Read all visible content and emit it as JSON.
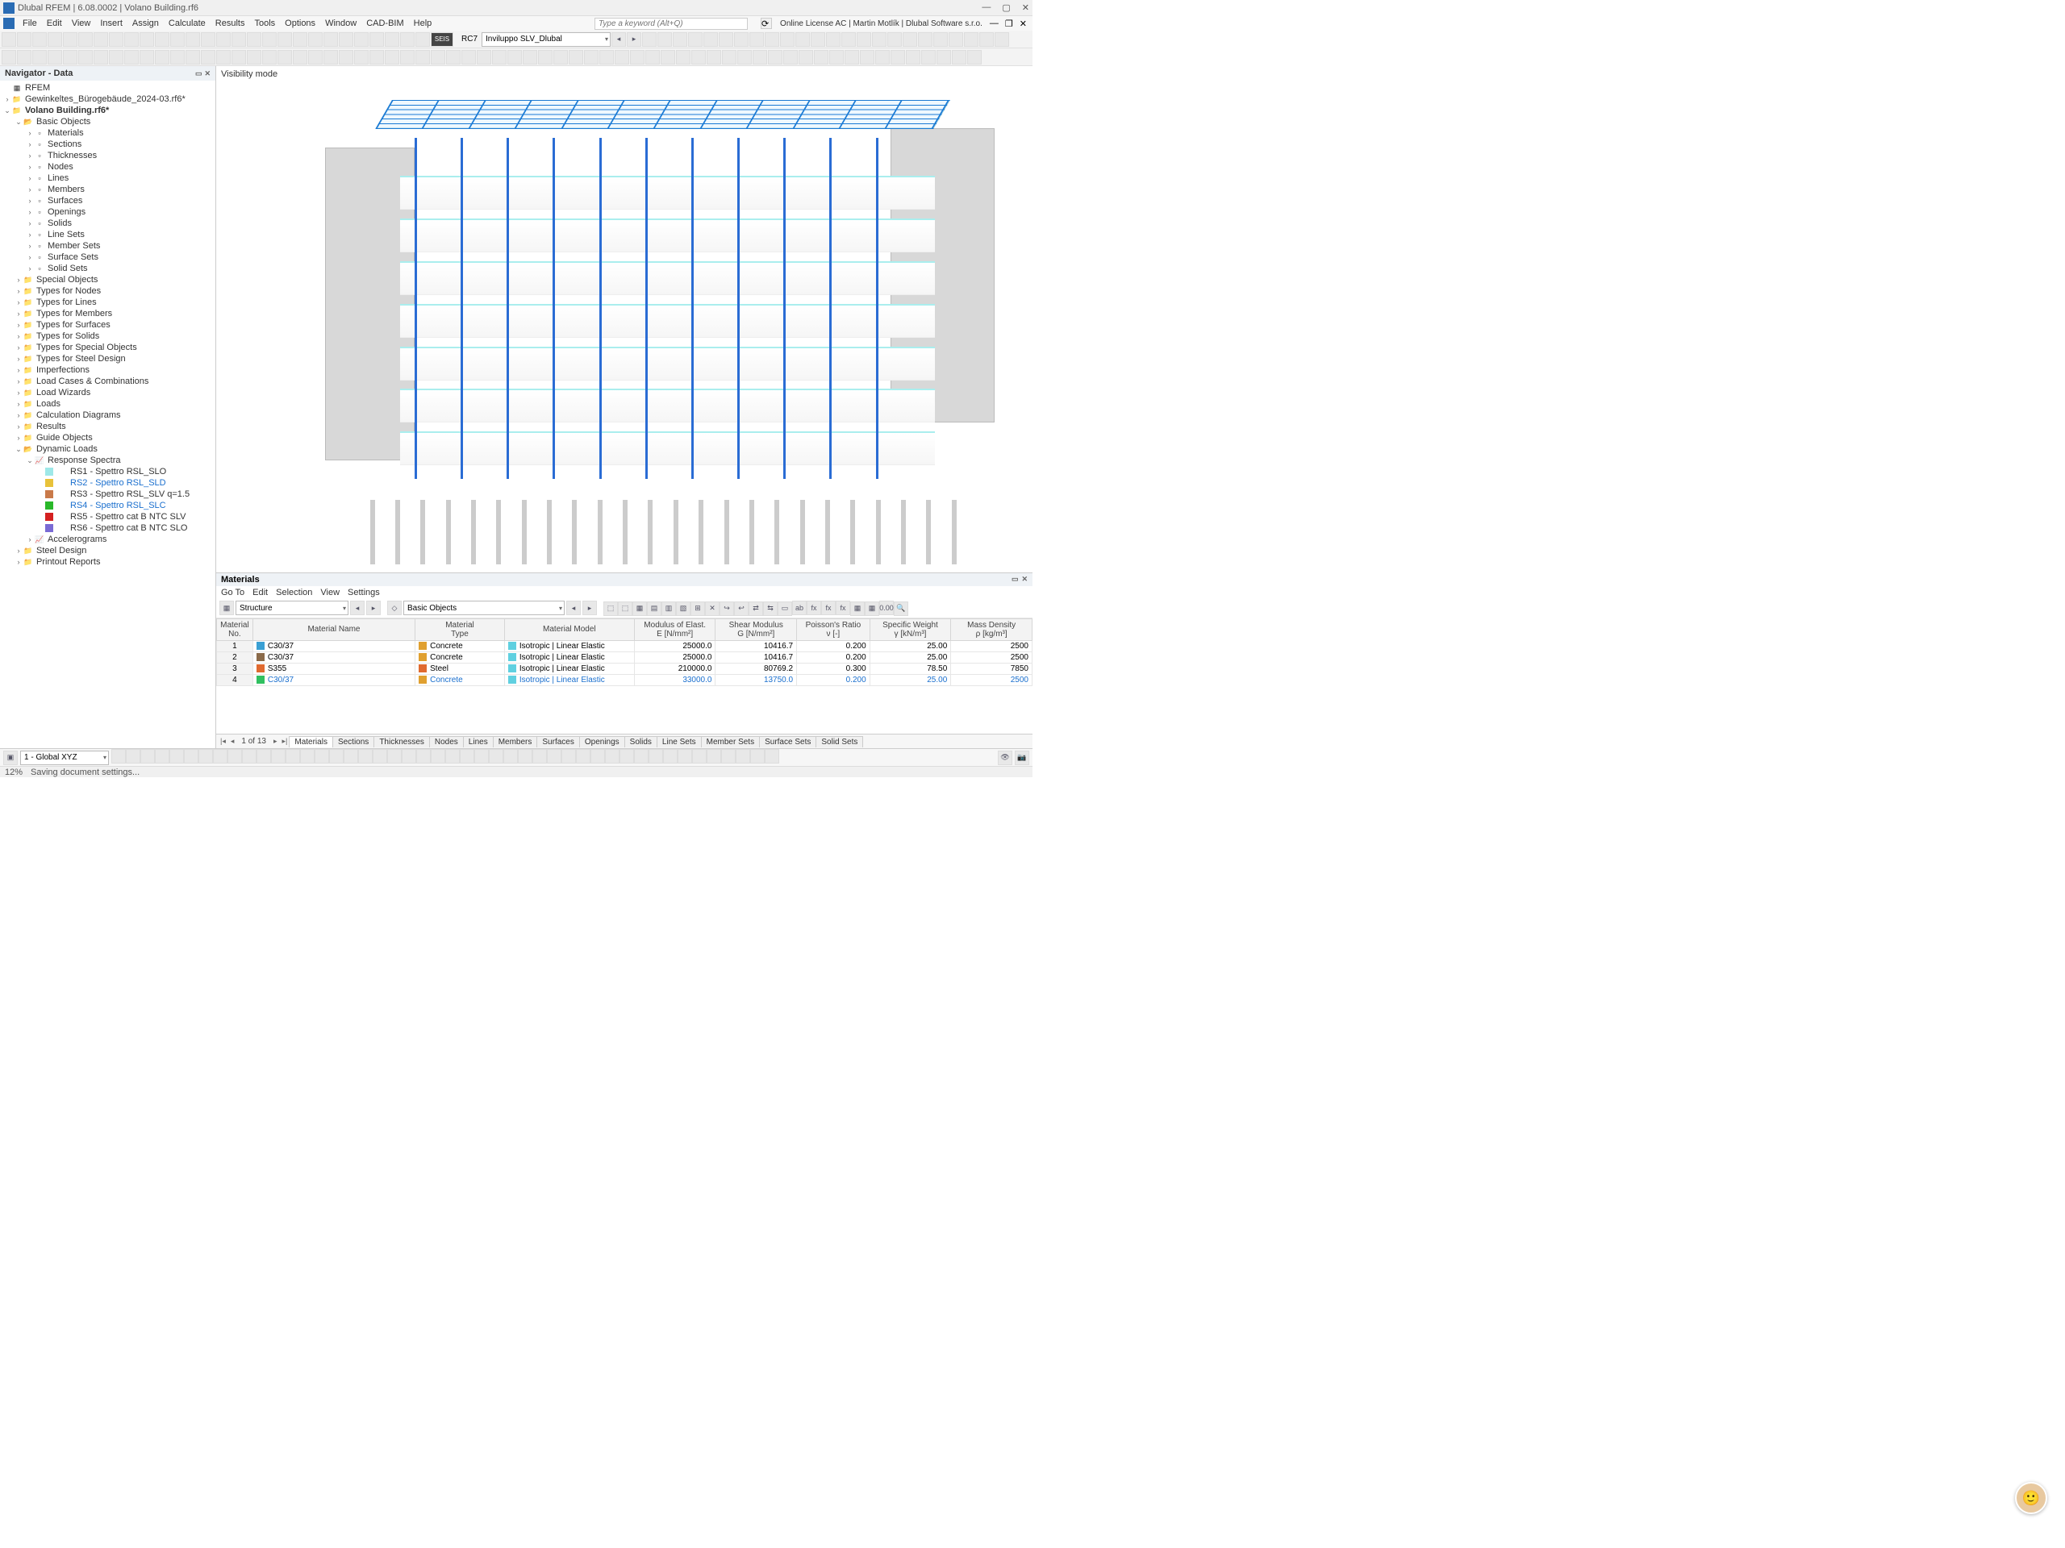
{
  "title": "Dlubal RFEM | 6.08.0002 | Volano Building.rf6",
  "menus": [
    "File",
    "Edit",
    "View",
    "Insert",
    "Assign",
    "Calculate",
    "Results",
    "Tools",
    "Options",
    "Window",
    "CAD-BIM",
    "Help"
  ],
  "keyword_placeholder": "Type a keyword (Alt+Q)",
  "license_text": "Online License AC | Martin Motlík | Dlubal Software s.r.o.",
  "toolbar1": {
    "rc_label": "RC7",
    "combo_value": "Inviluppo SLV_Dlubal",
    "seis": "SEIS"
  },
  "navigator": {
    "title": "Navigator - Data",
    "root": "RFEM",
    "files": [
      "Gewinkeltes_Bürogebäude_2024-03.rf6*",
      "Volano Building.rf6*"
    ],
    "basic_objects": {
      "label": "Basic Objects",
      "children": [
        "Materials",
        "Sections",
        "Thicknesses",
        "Nodes",
        "Lines",
        "Members",
        "Surfaces",
        "Openings",
        "Solids",
        "Line Sets",
        "Member Sets",
        "Surface Sets",
        "Solid Sets"
      ]
    },
    "groups": [
      "Special Objects",
      "Types for Nodes",
      "Types for Lines",
      "Types for Members",
      "Types for Surfaces",
      "Types for Solids",
      "Types for Special Objects",
      "Types for Steel Design",
      "Imperfections",
      "Load Cases & Combinations",
      "Load Wizards",
      "Loads",
      "Calculation Diagrams",
      "Results",
      "Guide Objects"
    ],
    "dynamic": {
      "label": "Dynamic Loads",
      "rs_label": "Response Spectra",
      "spectra": [
        {
          "name": "RS1 - Spettro RSL_SLO",
          "color": "#9ee8e8",
          "sel": false
        },
        {
          "name": "RS2 - Spettro RSL_SLD",
          "color": "#e8c23a",
          "sel": true
        },
        {
          "name": "RS3 - Spettro RSL_SLV q=1.5",
          "color": "#c97a4a",
          "sel": false
        },
        {
          "name": "RS4 - Spettro RSL_SLC",
          "color": "#2ab82a",
          "sel": true
        },
        {
          "name": "RS5 - Spettro cat B NTC SLV",
          "color": "#d42020",
          "sel": false
        },
        {
          "name": "RS6 - Spettro cat B NTC SLO",
          "color": "#7a6ad4",
          "sel": false
        }
      ],
      "accel": "Accelerograms"
    },
    "tail": [
      "Steel Design",
      "Printout Reports"
    ]
  },
  "viewport_label": "Visibility mode",
  "panel": {
    "title": "Materials",
    "menu": [
      "Go To",
      "Edit",
      "Selection",
      "View",
      "Settings"
    ],
    "structure_combo": "Structure",
    "basic_combo": "Basic Objects",
    "headers": [
      "Material No.",
      "Material Name",
      "Material Type",
      "Material Model",
      "Modulus of Elast. E [N/mm²]",
      "Shear Modulus G [N/mm²]",
      "Poisson's Ratio ν [-]",
      "Specific Weight γ [kN/m³]",
      "Mass Density ρ [kg/m³]"
    ],
    "rows": [
      {
        "no": "1",
        "color": "#3aa0d4",
        "name": "C30/37",
        "type": "Concrete",
        "type_c": "#e0a030",
        "model": "Isotropic | Linear Elastic",
        "model_c": "#60d0e0",
        "E": "25000.0",
        "G": "10416.7",
        "nu": "0.200",
        "gamma": "25.00",
        "rho": "2500"
      },
      {
        "no": "2",
        "color": "#8a6a4a",
        "name": "C30/37",
        "type": "Concrete",
        "type_c": "#e0a030",
        "model": "Isotropic | Linear Elastic",
        "model_c": "#60d0e0",
        "E": "25000.0",
        "G": "10416.7",
        "nu": "0.200",
        "gamma": "25.00",
        "rho": "2500"
      },
      {
        "no": "3",
        "color": "#e06a30",
        "name": "S355",
        "type": "Steel",
        "type_c": "#e06a30",
        "model": "Isotropic | Linear Elastic",
        "model_c": "#60d0e0",
        "E": "210000.0",
        "G": "80769.2",
        "nu": "0.300",
        "gamma": "78.50",
        "rho": "7850"
      },
      {
        "no": "4",
        "color": "#30c060",
        "name": "C30/37",
        "type": "Concrete",
        "type_c": "#e0a030",
        "model": "Isotropic | Linear Elastic",
        "model_c": "#60d0e0",
        "E": "33000.0",
        "G": "13750.0",
        "nu": "0.200",
        "gamma": "25.00",
        "rho": "2500",
        "blue": true
      }
    ]
  },
  "tabs": {
    "page": "1 of 13",
    "items": [
      "Materials",
      "Sections",
      "Thicknesses",
      "Nodes",
      "Lines",
      "Members",
      "Surfaces",
      "Openings",
      "Solids",
      "Line Sets",
      "Member Sets",
      "Surface Sets",
      "Solid Sets"
    ]
  },
  "bottom_combo": "1 - Global XYZ",
  "status": {
    "percent": "12%",
    "msg": "Saving document settings..."
  }
}
